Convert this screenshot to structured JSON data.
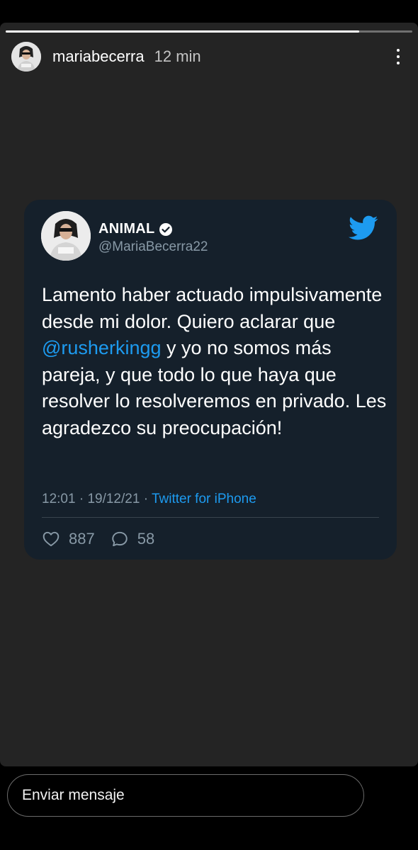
{
  "story": {
    "progress": 0.87,
    "username": "mariabecerra",
    "time": "12 min",
    "more_icon": "more-vertical-icon"
  },
  "tweet": {
    "display_name": "ANIMAL",
    "verified_icon": "verified-badge-icon",
    "handle": "@MariaBecerra22",
    "logo_icon": "twitter-bird-icon",
    "brand_color": "#1d9bf0",
    "text_part1": "Lamento haber actuado impulsivamente desde mi dolor. Quiero aclarar que ",
    "mention": "@rusherkingg",
    "text_part2": " y yo no somos más pareja, y que todo lo que haya que resolver lo resolveremos en privado. Les agradezco su preocupación!",
    "time": "12:01",
    "date": "19/12/21",
    "separator": "·",
    "source": "Twitter for iPhone",
    "likes": "887",
    "replies": "58"
  },
  "composer": {
    "placeholder": "Enviar mensaje"
  }
}
